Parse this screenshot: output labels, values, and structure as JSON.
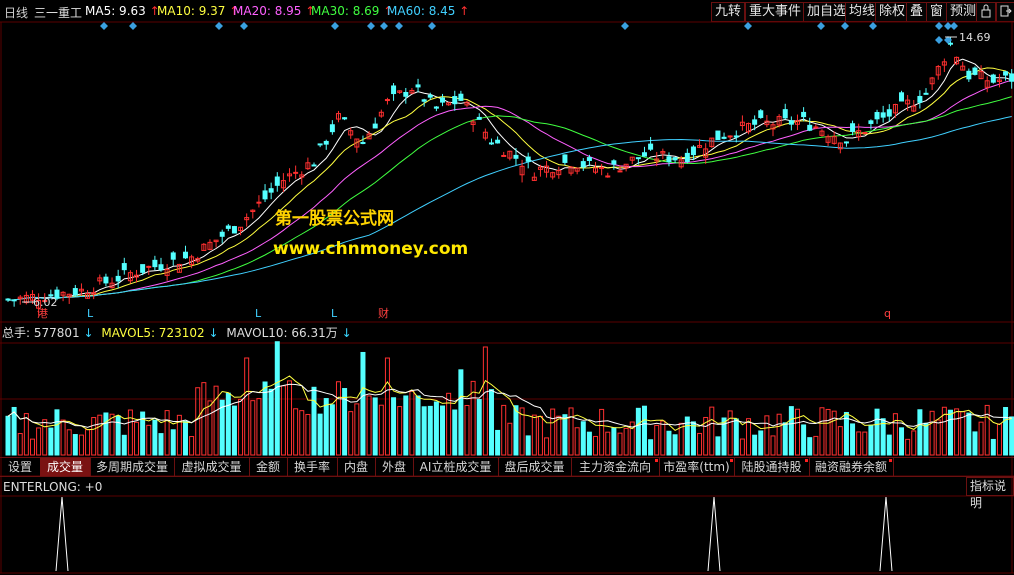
{
  "header": {
    "period": "日线",
    "stock_name": "三一重工",
    "ma": [
      {
        "label": "MA5: 9.63",
        "arrow": "↑",
        "color": "#ffffff"
      },
      {
        "label": "MA10: 9.37",
        "arrow": "↑",
        "color": "#ffff40"
      },
      {
        "label": "MA20: 8.95",
        "arrow": "↑",
        "color": "#ff60ff"
      },
      {
        "label": "MA30: 8.69",
        "arrow": "↑",
        "color": "#40ff40"
      },
      {
        "label": "MA60: 8.45",
        "arrow": "↑",
        "color": "#40d0ff"
      }
    ]
  },
  "toolbar": [
    "九转",
    "重大事件",
    "加自选",
    "均线",
    "除权",
    "叠",
    "窗",
    "预测"
  ],
  "price_panel": {
    "high_label": "14.69",
    "low_label": "6.02",
    "event_markers": [
      "港",
      "L",
      "L",
      "L",
      "财",
      "q"
    ]
  },
  "volume_header": {
    "total_label": "总手: 577801",
    "total_arrow": "↓",
    "mavol5_label": "MAVOL5: 723102",
    "mavol5_arrow": "↓",
    "mavol10_label": "MAVOL10: 66.31万",
    "mavol10_arrow": "↓"
  },
  "tabs": [
    "设置",
    "成交量",
    "多周期成交量",
    "虚拟成交量",
    "金额",
    "换手率",
    "内盘",
    "外盘",
    "AI立桩成交量",
    "盘后成交量",
    "主力资金流向",
    "市盈率(ttm)",
    "陆股通持股",
    "融资融券余额"
  ],
  "active_tab": "成交量",
  "indicator": {
    "label": "ENTERLONG: +0",
    "help_button": "指标说明"
  },
  "watermark": {
    "line1": "第一股票公式网",
    "line2": "www.chnmoney.com"
  },
  "colors": {
    "up": "#ff3030",
    "down": "#54ffff",
    "grid": "#5a0000",
    "background": "#000000"
  },
  "chart_data": {
    "type": "candlestick",
    "last_close": 9.6,
    "ma_values": {
      "MA5": 9.63,
      "MA10": 9.37,
      "MA20": 8.95,
      "MA30": 8.69,
      "MA60": 8.45
    },
    "marked_high": 14.69,
    "marked_low": 6.02,
    "volume": {
      "total": 577801,
      "mavol5": 723102,
      "mavol10": 663100
    },
    "enterlong": {
      "value": 0,
      "signals": 3
    }
  }
}
